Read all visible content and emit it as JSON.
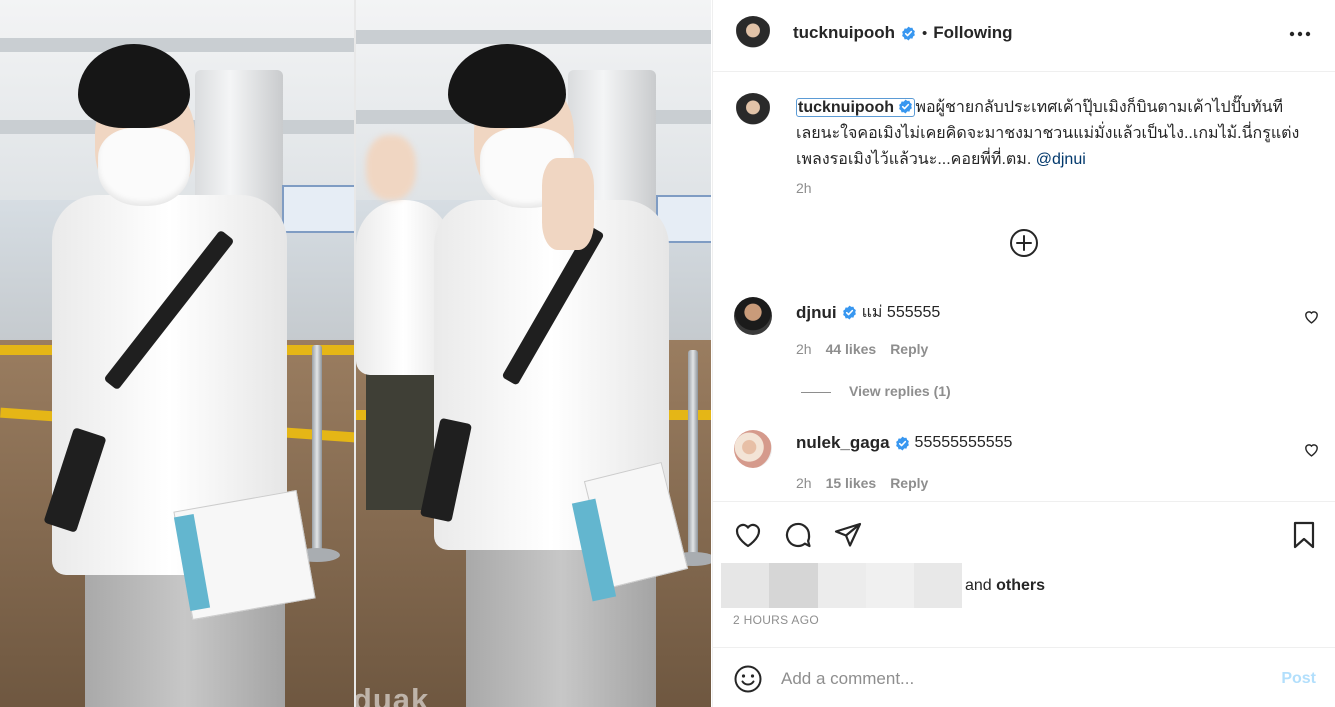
{
  "photo": {
    "watermark": "@puneiduak",
    "alt_description_icon": "photo-image"
  },
  "header": {
    "username": "tucknuipooh",
    "separator": "•",
    "follow_status": "Following",
    "more_icon": "more-options-icon"
  },
  "caption": {
    "username": "tucknuipooh",
    "text": "พอผู้ชายกลับประเทศเค้าปุ๊บเมิงก็บินตามเค้าไปปั๊บทันทีเลยนะใจคอเมิงไม่เคยคิดจะมาชงมาชวนแม่มั่งแล้วเป็นไง..เกมไม้.นี่กรูแต่งเพลงรอเมิงไว้แล้วนะ...คอยพี่ที่.ตม.",
    "mention": "@djnui",
    "time": "2h"
  },
  "comments": [
    {
      "username": "djnui",
      "text": "แม่ 555555",
      "time": "2h",
      "likes": "44 likes",
      "reply": "Reply"
    },
    {
      "username": "nulek_gaga",
      "text": "55555555555",
      "time": "2h",
      "likes": "15 likes",
      "reply": "Reply"
    }
  ],
  "view_replies": "View replies (1)",
  "liked_by": {
    "connector": "and",
    "others": "others"
  },
  "timestamp": "2 HOURS AGO",
  "add_comment": {
    "placeholder": "Add a comment...",
    "post_label": "Post"
  },
  "colors": {
    "verified_blue": "#0095f6",
    "post_disabled": "#b2dffc",
    "secondary_text": "#8e8e8e",
    "mention": "#00376b"
  }
}
